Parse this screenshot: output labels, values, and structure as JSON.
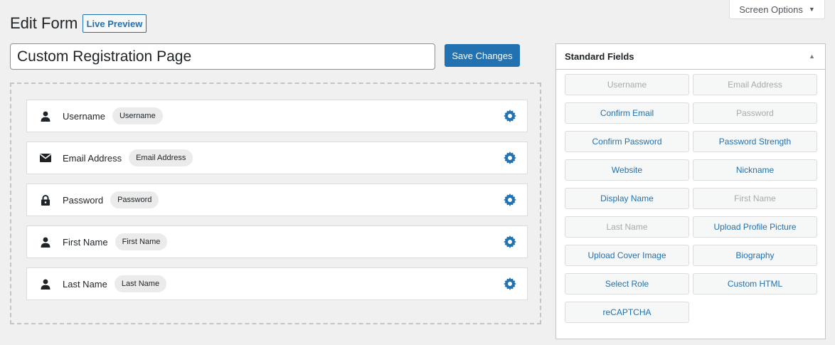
{
  "screen_options": {
    "label": "Screen Options",
    "caret": "▼"
  },
  "header": {
    "title": "Edit Form",
    "live_preview": "Live Preview"
  },
  "form": {
    "title_value": "Custom Registration Page",
    "save_label": "Save Changes"
  },
  "fields": [
    {
      "icon": "user-icon",
      "label": "Username",
      "pill": "Username"
    },
    {
      "icon": "email-icon",
      "label": "Email Address",
      "pill": "Email Address"
    },
    {
      "icon": "lock-icon",
      "label": "Password",
      "pill": "Password"
    },
    {
      "icon": "user-icon",
      "label": "First Name",
      "pill": "First Name"
    },
    {
      "icon": "user-icon",
      "label": "Last Name",
      "pill": "Last Name"
    }
  ],
  "panel": {
    "title": "Standard Fields",
    "collapse_glyph": "▲",
    "buttons": [
      {
        "label": "Username",
        "enabled": false
      },
      {
        "label": "Email Address",
        "enabled": false
      },
      {
        "label": "Confirm Email",
        "enabled": true
      },
      {
        "label": "Password",
        "enabled": false
      },
      {
        "label": "Confirm Password",
        "enabled": true
      },
      {
        "label": "Password Strength",
        "enabled": true
      },
      {
        "label": "Website",
        "enabled": true
      },
      {
        "label": "Nickname",
        "enabled": true
      },
      {
        "label": "Display Name",
        "enabled": true
      },
      {
        "label": "First Name",
        "enabled": false
      },
      {
        "label": "Last Name",
        "enabled": false
      },
      {
        "label": "Upload Profile Picture",
        "enabled": true
      },
      {
        "label": "Upload Cover Image",
        "enabled": true
      },
      {
        "label": "Biography",
        "enabled": true
      },
      {
        "label": "Select Role",
        "enabled": true
      },
      {
        "label": "Custom HTML",
        "enabled": true
      },
      {
        "label": "reCAPTCHA",
        "enabled": true
      }
    ]
  },
  "colors": {
    "accent": "#2271b1",
    "disabled_text": "#a7aaad",
    "background": "#f0f0f1"
  }
}
